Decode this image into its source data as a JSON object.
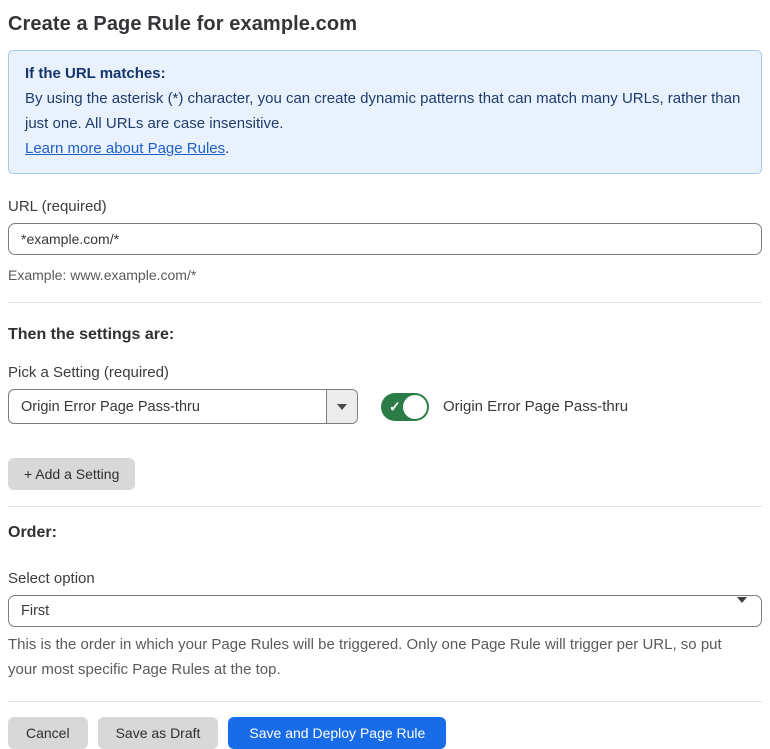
{
  "page": {
    "title": "Create a Page Rule for example.com"
  },
  "info_box": {
    "heading": "If the URL matches:",
    "body": "By using the asterisk (*) character, you can create dynamic patterns that can match many URLs, rather than just one. All URLs are case insensitive.",
    "link_text": "Learn more about Page Rules",
    "link_suffix": "."
  },
  "url_section": {
    "label": "URL (required)",
    "input_value": "*example.com/*",
    "example": "Example: www.example.com/*"
  },
  "settings_section": {
    "heading": "Then the settings are:",
    "pick_label": "Pick a Setting (required)",
    "selected_setting": "Origin Error Page Pass-thru",
    "toggle_state": "on",
    "toggle_check_glyph": "✓",
    "toggle_label": "Origin Error Page Pass-thru",
    "add_button_label": "+ Add a Setting"
  },
  "order_section": {
    "heading": "Order:",
    "select_label": "Select option",
    "selected_option": "First",
    "help_text": "This is the order in which your Page Rules will be triggered. Only one Page Rule will trigger per URL, so put your most specific Page Rules at the top."
  },
  "footer": {
    "cancel_label": "Cancel",
    "save_draft_label": "Save as Draft",
    "save_deploy_label": "Save and Deploy Page Rule"
  },
  "icons": {
    "setting_dropdown_caret": "caret-down",
    "order_select_caret": "caret-down",
    "toggle_check": "check"
  },
  "colors": {
    "info_background": "#e9f2fc",
    "info_border": "#a9c7e9",
    "info_text": "#1e3c6e",
    "link": "#1f5fc7",
    "toggle_on_green": "#2b7c46",
    "primary_button_blue": "#186ce8",
    "secondary_button_gray": "#d8d8d8",
    "input_border": "#7d7d7d",
    "divider": "#e0e0e0"
  }
}
